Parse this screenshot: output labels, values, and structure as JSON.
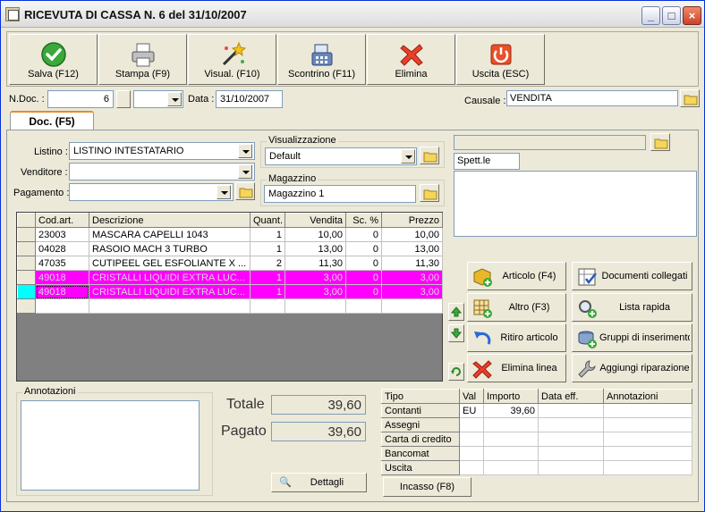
{
  "window": {
    "title": "RICEVUTA DI CASSA N.  6  del 31/10/2007"
  },
  "toolbar": {
    "save": "Salva (F12)",
    "print": "Stampa (F9)",
    "preview": "Visual. (F10)",
    "receipt": "Scontrino (F11)",
    "delete": "Elimina",
    "exit": "Uscita (ESC)"
  },
  "header": {
    "ndoc_label": "N.Doc. :",
    "ndoc_value": "6",
    "date_label": "Data :",
    "date_value": "31/10/2007",
    "causale_label": "Causale :",
    "causale_value": "VENDITA"
  },
  "tab": {
    "label": "Doc. (F5)"
  },
  "form": {
    "listino_label": "Listino :",
    "listino_value": "LISTINO INTESTATARIO",
    "venditore_label": "Venditore :",
    "venditore_value": "",
    "pagamento_label": "Pagamento :",
    "pagamento_value": "",
    "visualizzazione_title": "Visualizzazione",
    "visualizzazione_value": "Default",
    "magazzino_title": "Magazzino",
    "magazzino_value": "Magazzino 1",
    "customer_code": "",
    "customer_salutation": "Spett.le",
    "customer_address": ""
  },
  "items": {
    "columns": [
      "Cod.art.",
      "Descrizione",
      "Quant.",
      "Vendita",
      "Sc. %",
      "Prezzo"
    ],
    "rows": [
      {
        "code": "23003",
        "desc": "MASCARA CAPELLI 1043",
        "qty": "1",
        "sale": "10,00",
        "disc": "0",
        "price": "10,00"
      },
      {
        "code": "04028",
        "desc": "RASOIO MACH 3 TURBO",
        "qty": "1",
        "sale": "13,00",
        "disc": "0",
        "price": "13,00"
      },
      {
        "code": "47035",
        "desc": "CUTIPEEL GEL ESFOLIANTE X ...",
        "qty": "2",
        "sale": "11,30",
        "disc": "0",
        "price": "11,30"
      },
      {
        "code": "49018",
        "desc": "CRISTALLI LIQUIDI EXTRA LUC...",
        "qty": "1",
        "sale": "3,00",
        "disc": "0",
        "price": "3,00"
      },
      {
        "code": "49018",
        "desc": "CRISTALLI LIQUIDI EXTRA LUC...",
        "qty": "1",
        "sale": "3,00",
        "disc": "0",
        "price": "3,00"
      }
    ]
  },
  "actions": {
    "articolo": "Articolo (F4)",
    "documenti": "Documenti collegati",
    "altro": "Altro (F3)",
    "lista": "Lista rapida",
    "ritiro": "Ritiro articolo",
    "gruppi": "Gruppi di inserimento",
    "elimina_linea": "Elimina linea",
    "riparazione": "Aggiungi riparazione"
  },
  "notes": {
    "title": "Annotazioni",
    "value": ""
  },
  "totals": {
    "totale_label": "Totale",
    "totale_value": "39,60",
    "pagato_label": "Pagato",
    "pagato_value": "39,60",
    "details_button": "Dettagli"
  },
  "payments": {
    "columns": [
      "Tipo",
      "Val",
      "Importo",
      "Data eff.",
      "Annotazioni"
    ],
    "rows": [
      {
        "type": "Contanti",
        "val": "EU",
        "amount": "39,60",
        "date": "",
        "note": ""
      },
      {
        "type": "Assegni",
        "val": "",
        "amount": "",
        "date": "",
        "note": ""
      },
      {
        "type": "Carta di credito",
        "val": "",
        "amount": "",
        "date": "",
        "note": ""
      },
      {
        "type": "Bancomat",
        "val": "",
        "amount": "",
        "date": "",
        "note": ""
      },
      {
        "type": "Uscita",
        "val": "",
        "amount": "",
        "date": "",
        "note": ""
      }
    ],
    "incasso_button": "Incasso (F8)"
  },
  "colors": {
    "highlight_row": "#ff00ff",
    "selected_indicator": "#00ffff",
    "accent_tab": "#e68b2c"
  }
}
